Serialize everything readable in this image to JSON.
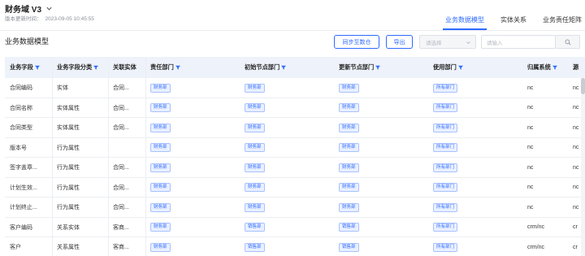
{
  "header": {
    "title": "财务域 V3",
    "update_label": "版本更新时间：",
    "update_time": "2023-09-05 10:45:55"
  },
  "tabs": [
    {
      "label": "业务数据模型",
      "active": true
    },
    {
      "label": "实体关系",
      "active": false
    },
    {
      "label": "业务责任矩阵",
      "active": false
    }
  ],
  "section_title": "业务数据模型",
  "toolbar": {
    "sync_label": "同步至数仓",
    "export_label": "导出",
    "select_placeholder": "请选择",
    "search_placeholder": "请输入"
  },
  "columns": [
    "业务字段",
    "业务字段分类",
    "关联实体",
    "责任部门",
    "初始节点部门",
    "更新节点部门",
    "使用部门",
    "归属系统",
    "源"
  ],
  "rows": [
    {
      "field": "合同编码",
      "category": "实体",
      "entity": "合同...",
      "owner": "财务部",
      "init": "财务部",
      "update": "财务部",
      "usage": "所有部门",
      "system": "nc",
      "src": "nc"
    },
    {
      "field": "合同名称",
      "category": "实体属性",
      "entity": "合同...",
      "owner": "财务部",
      "init": "财务部",
      "update": "财务部",
      "usage": "所有部门",
      "system": "nc",
      "src": "nc"
    },
    {
      "field": "合同类型",
      "category": "实体属性",
      "entity": "合同...",
      "owner": "财务部",
      "init": "财务部",
      "update": "财务部",
      "usage": "所有部门",
      "system": "nc",
      "src": "nc"
    },
    {
      "field": "版本号",
      "category": "行为属性",
      "entity": "",
      "owner": "财务部",
      "init": "财务部",
      "update": "财务部",
      "usage": "所有部门",
      "system": "nc",
      "src": "nc"
    },
    {
      "field": "签字盖章...",
      "category": "行为属性",
      "entity": "合同...",
      "owner": "财务部",
      "init": "财务部",
      "update": "财务部",
      "usage": "所有部门",
      "system": "nc",
      "src": "nc"
    },
    {
      "field": "计划生效...",
      "category": "行为属性",
      "entity": "合同...",
      "owner": "财务部",
      "init": "财务部",
      "update": "财务部",
      "usage": "所有部门",
      "system": "nc",
      "src": "nc"
    },
    {
      "field": "计划终止...",
      "category": "行为属性",
      "entity": "合同...",
      "owner": "财务部",
      "init": "财务部",
      "update": "财务部",
      "usage": "所有部门",
      "system": "nc",
      "src": "nc"
    },
    {
      "field": "客户编码",
      "category": "关系实体",
      "entity": "客商...",
      "owner": "财务部",
      "init": "销售部",
      "update": "销售部",
      "usage": "所有部门",
      "system": "crm/nc",
      "src": "cr"
    },
    {
      "field": "客户",
      "category": "关系属性",
      "entity": "客商...",
      "owner": "财务部",
      "init": "销售部",
      "update": "销售部",
      "usage": "所有部门",
      "system": "crm/nc",
      "src": "cr"
    }
  ],
  "colors": {
    "accent": "#2f6bff",
    "header_bg": "#eef2fa",
    "tag_bg": "#e9f0ff"
  }
}
